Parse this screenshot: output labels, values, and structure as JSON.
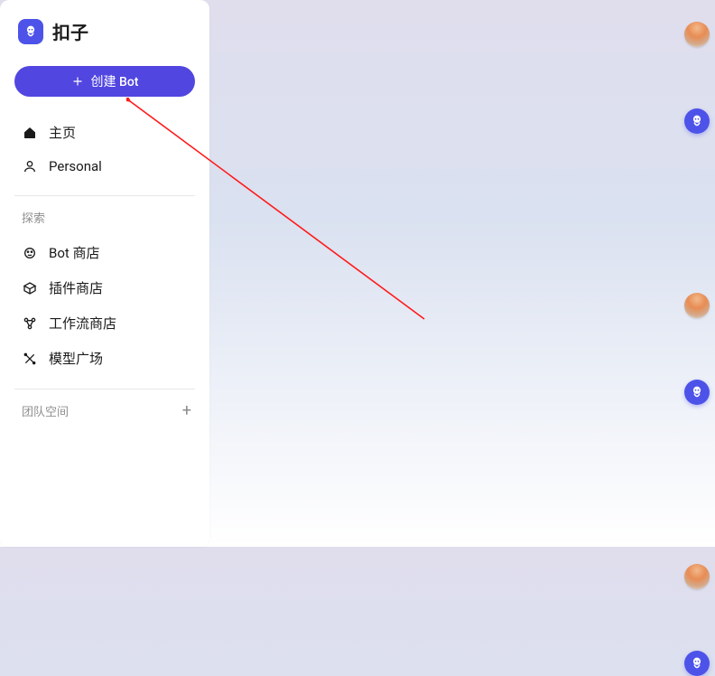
{
  "brand": {
    "name": "扣子"
  },
  "create_button": {
    "label": "创建 Bot"
  },
  "nav": {
    "primary": [
      {
        "icon": "home-icon",
        "label": "主页"
      },
      {
        "icon": "person-icon",
        "label": "Personal"
      }
    ],
    "section_label": "探索",
    "explore": [
      {
        "icon": "bot-icon",
        "label": "Bot 商店"
      },
      {
        "icon": "cube-icon",
        "label": "插件商店"
      },
      {
        "icon": "workflow-icon",
        "label": "工作流商店"
      },
      {
        "icon": "compass-icon",
        "label": "模型广场"
      }
    ]
  },
  "team": {
    "label": "团队空间"
  },
  "brand_color": "#4d53e8",
  "brand_color_dark": "#5246e0"
}
